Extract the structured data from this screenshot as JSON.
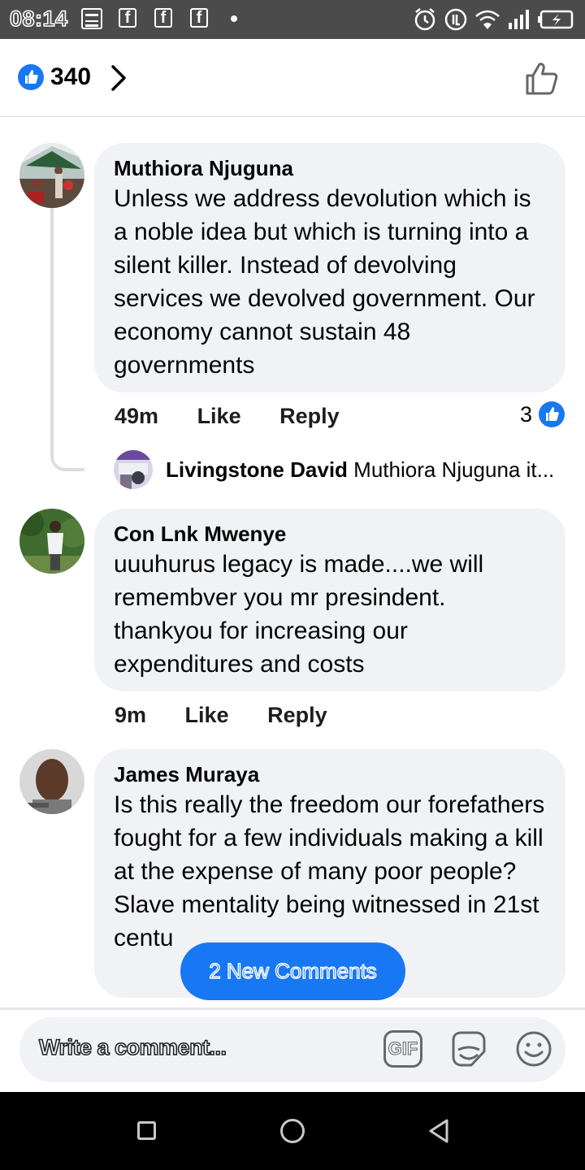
{
  "status_bar": {
    "time": "08:14",
    "fb_letter": "f",
    "battery_symbol": "⚡"
  },
  "header": {
    "like_count": "340"
  },
  "comments": [
    {
      "author": "Muthiora Njuguna",
      "text": "Unless we address devolution which is a noble idea but which is turning into a silent killer. Instead of devolving services we devolved government. Our economy cannot sustain 48 governments",
      "time": "49m",
      "like_label": "Like",
      "reply_label": "Reply",
      "reaction_count": "3",
      "reply_preview": {
        "author": "Livingstone David",
        "text": "Muthiora Njuguna it..."
      }
    },
    {
      "author": "Con Lnk Mwenye",
      "text": "uuuhurus legacy is made....we will remembver you mr presindent. thankyou for increasing our expenditures and costs",
      "time": "9m",
      "like_label": "Like",
      "reply_label": "Reply"
    },
    {
      "author": "James Muraya",
      "text": "Is this really the freedom our forefathers fought for a few individuals making a kill at the expense of many poor people?Slave mentality being witnessed in 21st centu"
    }
  ],
  "new_comments_label": "2 New Comments",
  "composer": {
    "placeholder": "Write a comment...",
    "gif_label": "GIF"
  },
  "colors": {
    "accent": "#1877f2",
    "bubble": "#f0f2f5",
    "status_bar": "#4b4b4b"
  }
}
